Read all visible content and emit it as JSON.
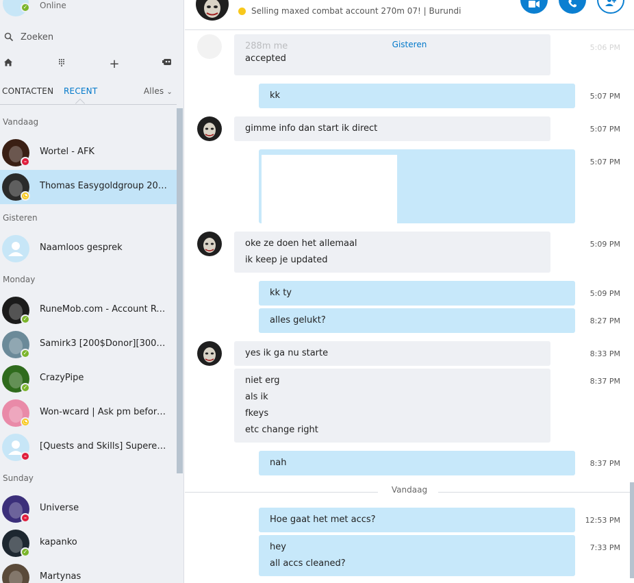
{
  "profile": {
    "status": "Online"
  },
  "search": {
    "placeholder": "Zoeken"
  },
  "tabs": {
    "contacts": "CONTACTEN",
    "recent": "RECENT",
    "filter": "Alles"
  },
  "sections": [
    {
      "title": "Vandaag",
      "items": [
        {
          "name": "Wortel - AFK",
          "status": "busy",
          "avatar_color": "#3a1f14"
        },
        {
          "name": "Thomas Easygoldgroup 200$...",
          "status": "away",
          "avatar_color": "#2a2a2a",
          "selected": true
        }
      ]
    },
    {
      "title": "Gisteren",
      "items": [
        {
          "name": "Naamloos gesprek",
          "status": "none",
          "avatar_color": "#c7e6f7"
        }
      ]
    },
    {
      "title": "Monday",
      "items": [
        {
          "name": "RuneMob.com - Account Rent...",
          "status": "online",
          "avatar_color": "#1b1b1b"
        },
        {
          "name": "Samirk3 [200$Donor][300+Vo...",
          "status": "online",
          "avatar_color": "#6b8a99"
        },
        {
          "name": "CrazyPipe",
          "status": "online",
          "avatar_color": "#2f6b1d"
        },
        {
          "name": "Won-wcard | Ask pm before t...",
          "status": "away",
          "avatar_color": "#e98aa8"
        },
        {
          "name": "[Quests and Skills] Supered [T...",
          "status": "busy",
          "avatar_color": "#c7e6f7"
        }
      ]
    },
    {
      "title": "Sunday",
      "items": [
        {
          "name": "Universe",
          "status": "busy",
          "avatar_color": "#3b2f7a"
        },
        {
          "name": "kapanko",
          "status": "online",
          "avatar_color": "#1d2730"
        },
        {
          "name": "Martynas",
          "status": "none",
          "avatar_color": "#5a4a3a"
        }
      ]
    }
  ],
  "header": {
    "mood": "Selling maxed combat account 270m 07!  |  Burundi"
  },
  "conversation": {
    "date_gisteren": "Gisteren",
    "date_vandaag": "Vandaag",
    "partial_prev": {
      "line1": "288m me",
      "line2": "accepted",
      "time": "5:06 PM"
    },
    "messages": [
      {
        "dir": "out",
        "lines": [
          "kk"
        ],
        "time": "5:07 PM"
      },
      {
        "dir": "in",
        "lines": [
          "gimme info dan start ik direct"
        ],
        "time": "5:07 PM"
      },
      {
        "dir": "out",
        "image": true,
        "time": "5:07 PM"
      },
      {
        "dir": "in",
        "lines": [
          "oke ze doen het allemaal",
          "ik keep je updated"
        ],
        "time": "5:09 PM"
      },
      {
        "dir": "out",
        "lines": [
          "kk ty"
        ],
        "time": "5:09 PM"
      },
      {
        "dir": "out",
        "lines": [
          "alles gelukt?"
        ],
        "time": "8:27 PM"
      },
      {
        "dir": "in",
        "lines": [
          "yes ik ga nu starte"
        ],
        "time": "8:33 PM"
      },
      {
        "dir": "in",
        "lines": [
          "niet erg",
          "als ik",
          "fkeys",
          "etc change right"
        ],
        "time": "8:37 PM"
      },
      {
        "dir": "out",
        "lines": [
          "nah"
        ],
        "time": "8:37 PM"
      },
      {
        "dir": "out",
        "lines": [
          "Hoe gaat het met accs?"
        ],
        "time": "12:53 PM"
      },
      {
        "dir": "out",
        "lines": [
          "hey",
          "all accs cleaned?"
        ],
        "time": "7:33 PM"
      }
    ]
  },
  "colors": {
    "accent": "#0078ca",
    "online": "#7bb52b",
    "busy": "#e01e3c",
    "away": "#f8c81c",
    "outgoing": "#c7e8fa",
    "incoming": "#eef0f4"
  }
}
